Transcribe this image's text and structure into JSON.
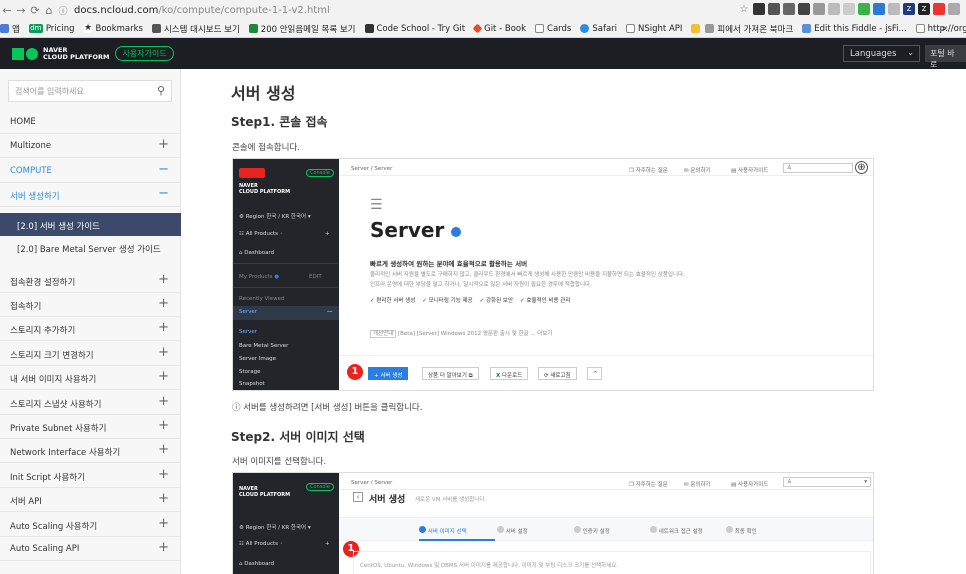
{
  "browser": {
    "url_host": "docs.ncloud.com",
    "url_path": "/ko/compute/compute-1-1-v2.html",
    "bookmarks": [
      {
        "label": "앱",
        "color": "#4a7bd8"
      },
      {
        "label": "Pricing",
        "color": "#0b9e5a",
        "prefix": "dm"
      },
      {
        "label": "Bookmarks",
        "color": "#444"
      },
      {
        "label": "시스템 대시보드 보기",
        "color": "#555"
      },
      {
        "label": "200 안읽음메일 목록 보기",
        "color": "#1b8a3a"
      },
      {
        "label": "Code School - Try Git",
        "color": "#333"
      },
      {
        "label": "Git - Book",
        "color": "#e04e2b"
      },
      {
        "label": "Cards",
        "color": "#888"
      },
      {
        "label": "Safari",
        "color": "#2a8de0"
      },
      {
        "label": "NSight API",
        "color": "#888"
      },
      {
        "label": "피에서 가져온 북마크",
        "color": "#999"
      },
      {
        "label": "Edit this Fiddle - jsFi...",
        "color": "#5b8fd8"
      },
      {
        "label": "http://orguser.naver...",
        "color": "#888"
      }
    ],
    "more": "»"
  },
  "header": {
    "logo_line1": "NAVER",
    "logo_line2": "CLOUD PLATFORM",
    "guide_badge": "사용자가이드",
    "language_label": "Languages",
    "right_button": "포털 바로"
  },
  "sidebar": {
    "search_placeholder": "검색어를 입력하세요",
    "items": [
      {
        "label": "HOME",
        "toggle": "",
        "style": "normal"
      },
      {
        "label": "Multizone",
        "toggle": "+",
        "style": "normal"
      },
      {
        "label": "COMPUTE",
        "toggle": "−",
        "style": "blue"
      },
      {
        "label": "서버 생성하기",
        "toggle": "−",
        "style": "blue"
      }
    ],
    "subitems": [
      {
        "label": "[2.0] 서버 생성 가이드",
        "active": true
      },
      {
        "label": "[2.0] Bare Metal Server 생성 가이드",
        "active": false
      }
    ],
    "items2": [
      {
        "label": "접속환경 설정하기",
        "toggle": "+"
      },
      {
        "label": "접속하기",
        "toggle": "+"
      },
      {
        "label": "스토리지 추가하기",
        "toggle": "+"
      },
      {
        "label": "스토리지 크기 변경하기",
        "toggle": "+"
      },
      {
        "label": "내 서버 이미지 사용하기",
        "toggle": "+"
      },
      {
        "label": "스토리지 스냅샷 사용하기",
        "toggle": "+"
      },
      {
        "label": "Private Subnet 사용하기",
        "toggle": "+"
      },
      {
        "label": "Network Interface 사용하기",
        "toggle": "+"
      },
      {
        "label": "Init Script 사용하기",
        "toggle": "+"
      },
      {
        "label": "서버 API",
        "toggle": "+"
      },
      {
        "label": "Auto Scaling 사용하기",
        "toggle": "+"
      },
      {
        "label": "Auto Scaling API",
        "toggle": "+"
      }
    ]
  },
  "main": {
    "title": "서버 생성",
    "step1_title": "Step1. 콘솔 접속",
    "step1_text": "콘솔에 접속합니다.",
    "step1_note": "ⓘ 서버를 생성하려면 [서버 생성] 버튼을 클릭합니다.",
    "step2_title": "Step2. 서버 이미지 선택",
    "step2_text": "서버 이미지를 선택합니다."
  },
  "shot1": {
    "side_console": "Console",
    "side_region": "Region 한국 / KR 한국어",
    "side_all_products": "All Products",
    "side_dashboard": "Dashboard",
    "side_my_products": "My Products",
    "side_edit": "EDIT",
    "side_recent": "Recently Viewed",
    "side_server": "Server",
    "side_server_children": [
      "Server",
      "Bare Metal Server",
      "Server Image",
      "Storage",
      "Snapshot"
    ],
    "breadcrumb": "Server / Server",
    "top_links": [
      "자주하는 질문",
      "문의하기",
      "사용자가이드"
    ],
    "page_title": "Server",
    "desc_title": "빠르게 생성하여 원하는 분야에 효율적으로 활용하는 서버",
    "desc_1": "물리적인 서버 자원을 별도로 구매하지 않고, 클라우드 환경에서 빠르게 생성해 사용한 만큼만 비용을 지불하면 되는 효율적인 상품입니다.",
    "desc_2": "인프라 운영에 대한 부담을 덜고 하거나, 일시적으로 많은 서버 자원이 필요한 경우에 적합합니다.",
    "features": [
      "편리한 서버 생성",
      "모니터링 기능 제공",
      "강화된 보안",
      "효율적인 비용 관리"
    ],
    "notice": "[Beta] [Server] Windows 2012 영문판 출시 및 한글 ... 더보기",
    "notice_tag": "개선안내",
    "btn_create": "+ 서버 생성",
    "btn_more": "상품 더 알아보기 ⧉",
    "btn_download": "다운로드",
    "btn_refresh": "새로고침",
    "btn_up": "^",
    "badge": "1"
  },
  "shot2": {
    "breadcrumb": "Server / Server",
    "top_links": [
      "자주하는 질문",
      "문의하기",
      "사용자가이드"
    ],
    "page_title": "서버 생성",
    "page_sub": "새로운 VM 서버를 생성합니다.",
    "steps": [
      "서버 이미지 선택",
      "서버 설정",
      "인증키 설정",
      "네트워크 접근 설정",
      "최종 확인"
    ],
    "desc": "CentOS, Ubuntu, Windows 및 DBMS 서버 이미지를 제공합니다. 이미지 및 부팅 디스크 크기를 선택하세요.",
    "side_region": "Region 한국 / KR 한국어",
    "side_all_products": "All Products",
    "side_dashboard": "Dashboard",
    "badge": "1"
  },
  "colors": {
    "accent_green": "#03c75a",
    "link_blue": "#2b8bd8",
    "badge_red": "#e8221d",
    "btn_blue": "#2a7de1"
  }
}
